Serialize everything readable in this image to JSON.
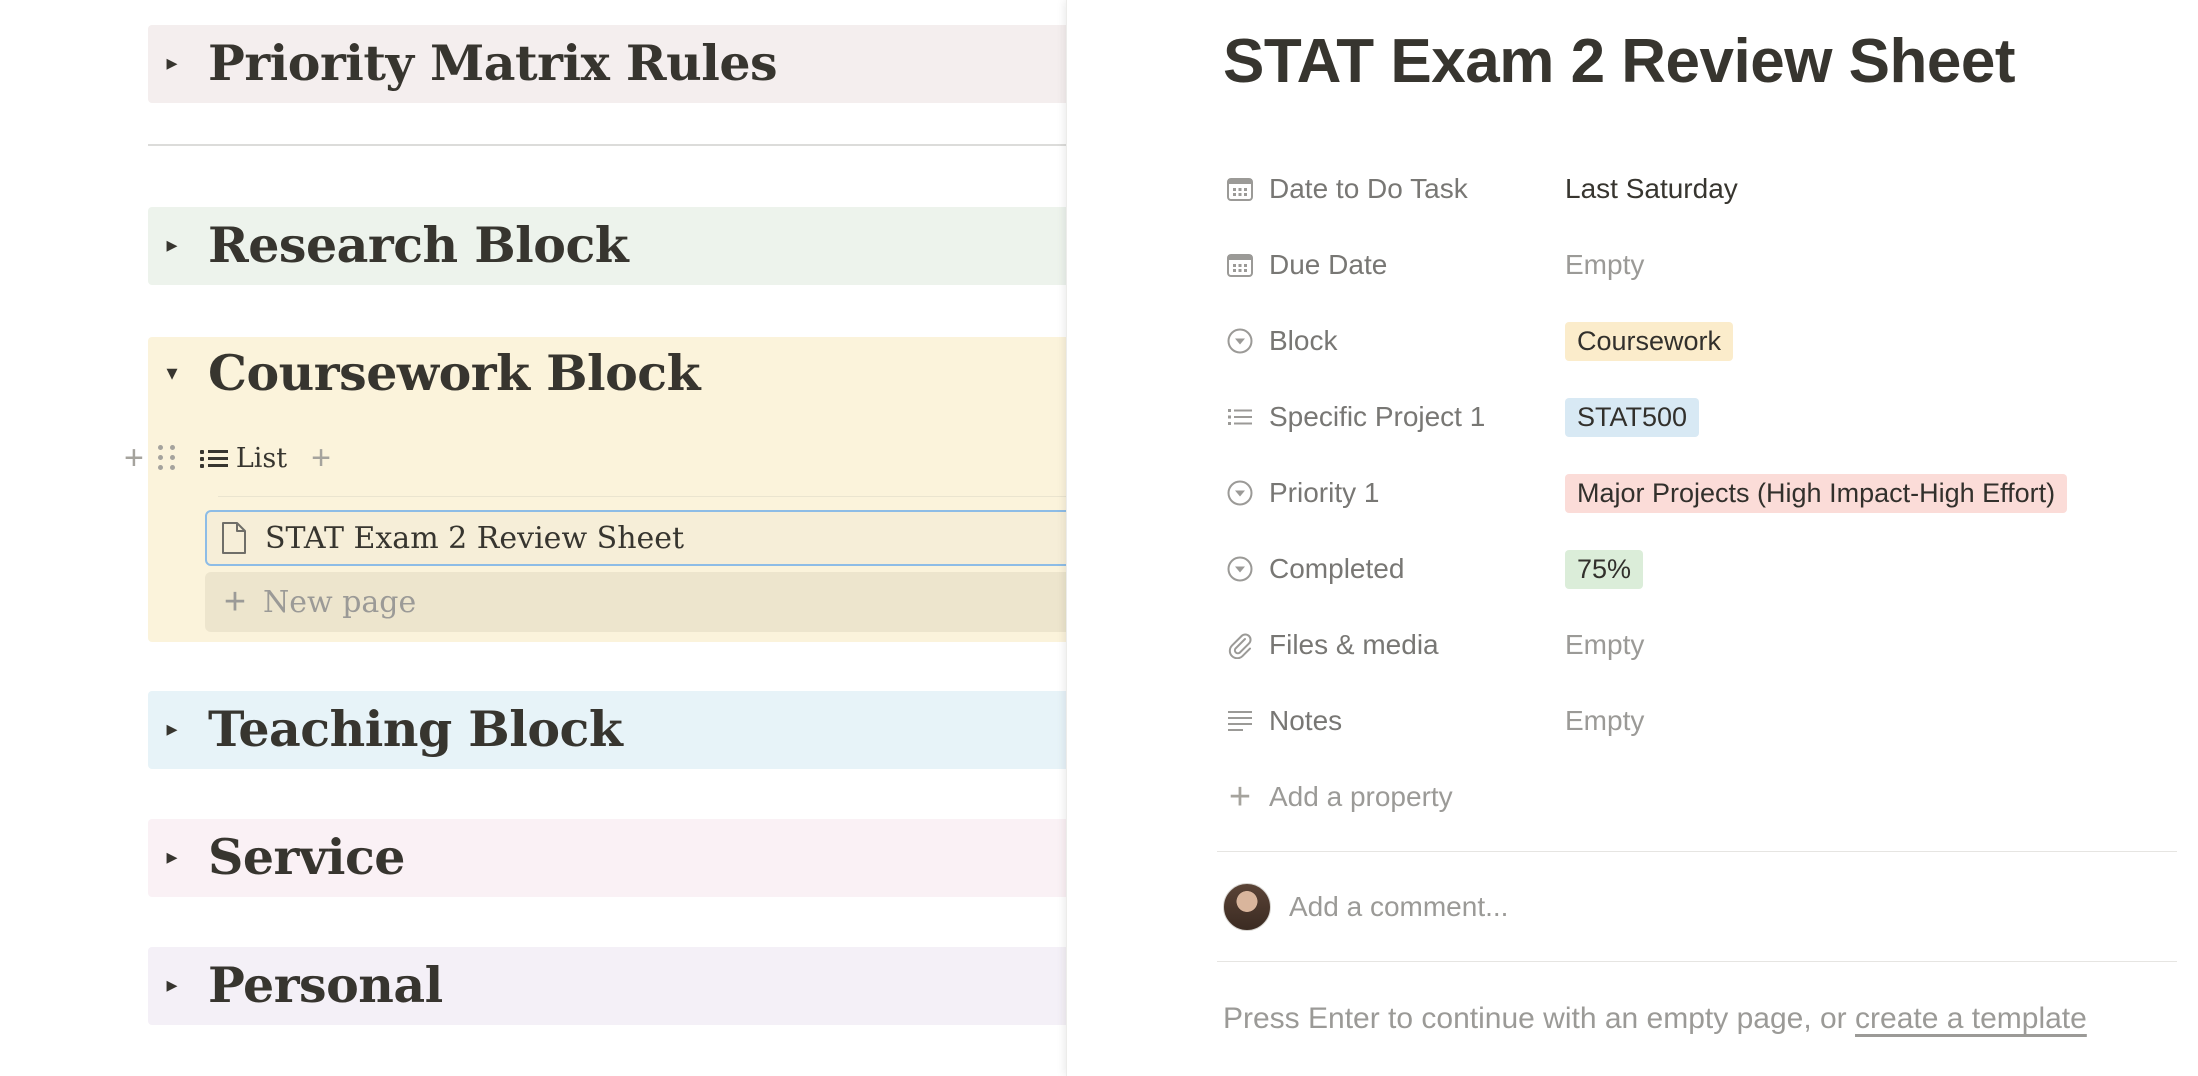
{
  "left_page": {
    "toggle_headings": [
      {
        "label": "Priority Matrix Rules",
        "expanded": false,
        "bg": "#f4eeee"
      },
      {
        "label": "Research Block",
        "expanded": false,
        "bg": "#edf3ec"
      },
      {
        "label": "Coursework Block",
        "expanded": true,
        "bg": "#fbf3db"
      },
      {
        "label": "Teaching Block",
        "expanded": false,
        "bg": "#e7f3f8"
      },
      {
        "label": "Service",
        "expanded": false,
        "bg": "#faf1f5"
      },
      {
        "label": "Personal",
        "expanded": false,
        "bg": "#f4f0f7"
      }
    ],
    "database": {
      "view_label": "List",
      "items": [
        "STAT Exam 2 Review Sheet"
      ],
      "new_page_label": "New page"
    }
  },
  "peek": {
    "title": "STAT Exam 2 Review Sheet",
    "properties": [
      {
        "name": "Date to Do Task",
        "icon": "calendar-icon",
        "value": "Last Saturday",
        "empty": false
      },
      {
        "name": "Due Date",
        "icon": "calendar-icon",
        "value": "Empty",
        "empty": true
      },
      {
        "name": "Block",
        "icon": "select-icon",
        "tag": "Coursework",
        "tag_bg": "#fbeccb"
      },
      {
        "name": "Specific Project 1",
        "icon": "list-icon",
        "tag": "STAT500",
        "tag_bg": "#d8e9f4"
      },
      {
        "name": "Priority 1",
        "icon": "select-icon",
        "tag": "Major Projects (High Impact-High Effort)",
        "tag_bg": "#fbdcd8"
      },
      {
        "name": "Completed",
        "icon": "select-icon",
        "tag": "75%",
        "tag_bg": "#dbedd9"
      },
      {
        "name": "Files & media",
        "icon": "paperclip-icon",
        "value": "Empty",
        "empty": true
      },
      {
        "name": "Notes",
        "icon": "text-lines-icon",
        "value": "Empty",
        "empty": true
      }
    ],
    "add_property_label": "Add a property",
    "comment_placeholder": "Add a comment...",
    "footer_prefix": "Press Enter to continue with an empty page, or ",
    "footer_link": "create a template"
  }
}
